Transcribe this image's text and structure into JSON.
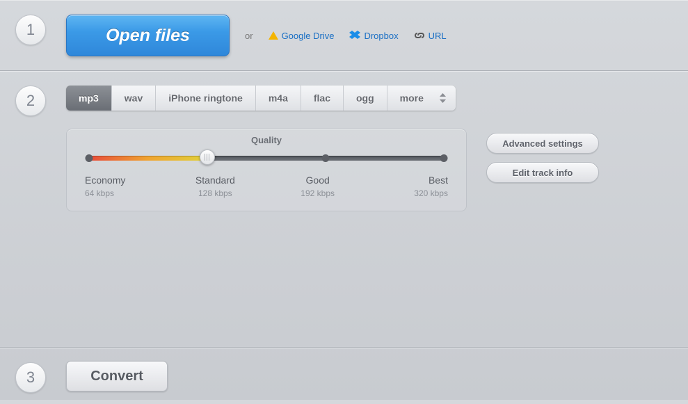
{
  "step1": {
    "number": "1",
    "open_label": "Open files",
    "or_label": "or",
    "gdrive_label": "Google Drive",
    "dropbox_label": "Dropbox",
    "url_label": "URL"
  },
  "step2": {
    "number": "2",
    "tabs": [
      "mp3",
      "wav",
      "iPhone ringtone",
      "m4a",
      "flac",
      "ogg",
      "more"
    ],
    "active_tab": 0,
    "quality_title": "Quality",
    "levels": [
      {
        "name": "Economy",
        "rate": "64 kbps"
      },
      {
        "name": "Standard",
        "rate": "128 kbps"
      },
      {
        "name": "Good",
        "rate": "192 kbps"
      },
      {
        "name": "Best",
        "rate": "320 kbps"
      }
    ],
    "selected_level": 1,
    "advanced_label": "Advanced settings",
    "edit_track_label": "Edit track info"
  },
  "step3": {
    "number": "3",
    "convert_label": "Convert"
  }
}
